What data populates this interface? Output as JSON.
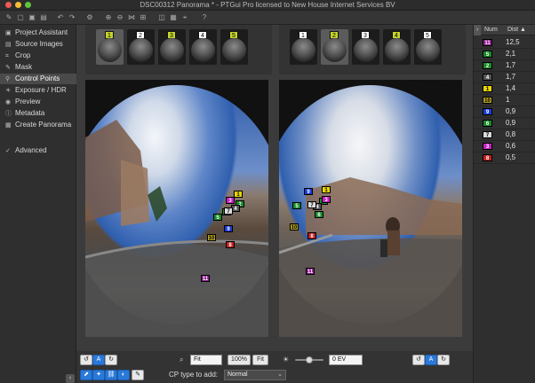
{
  "window": {
    "title": "DSC00312 Panorama * - PTGui Pro licensed to New House Internet Services BV"
  },
  "sidebar": {
    "items": [
      {
        "label": "Project Assistant",
        "icon": "project-assistant-icon",
        "glyph": "▣"
      },
      {
        "label": "Source Images",
        "icon": "source-images-icon",
        "glyph": "▤"
      },
      {
        "label": "Crop",
        "icon": "crop-icon",
        "glyph": "⌗"
      },
      {
        "label": "Mask",
        "icon": "mask-icon",
        "glyph": "✎"
      },
      {
        "label": "Control Points",
        "icon": "control-points-icon",
        "glyph": "⚲"
      },
      {
        "label": "Exposure / HDR",
        "icon": "exposure-icon",
        "glyph": "☀"
      },
      {
        "label": "Preview",
        "icon": "preview-icon",
        "glyph": "◉"
      },
      {
        "label": "Metadata",
        "icon": "metadata-icon",
        "glyph": "ⓘ"
      },
      {
        "label": "Create Panorama",
        "icon": "create-panorama-icon",
        "glyph": "▦"
      },
      {
        "label": "Advanced",
        "icon": "advanced-icon",
        "glyph": "✓"
      }
    ]
  },
  "thumbs_left": [
    {
      "n": "1",
      "color": "#c4d42a"
    },
    {
      "n": "2",
      "color": "#ffffff"
    },
    {
      "n": "3",
      "color": "#c4d42a"
    },
    {
      "n": "4",
      "color": "#ffffff"
    },
    {
      "n": "5",
      "color": "#c4d42a"
    }
  ],
  "thumbs_right": [
    {
      "n": "1",
      "color": "#ffffff"
    },
    {
      "n": "2",
      "color": "#c4d42a"
    },
    {
      "n": "3",
      "color": "#ffffff"
    },
    {
      "n": "4",
      "color": "#c4d42a"
    },
    {
      "n": "5",
      "color": "#ffffff"
    }
  ],
  "points_left": [
    {
      "n": "1",
      "color": "#e8d800",
      "text": "#000"
    },
    {
      "n": "2",
      "color": "#1a8a2a",
      "text": "#fff"
    },
    {
      "n": "3",
      "color": "#c020c0",
      "text": "#fff"
    },
    {
      "n": "4",
      "color": "#555555",
      "text": "#fff"
    },
    {
      "n": "5",
      "color": "#1a8a2a",
      "text": "#fff"
    },
    {
      "n": "6",
      "color": "#1a8a2a",
      "text": "#fff"
    },
    {
      "n": "7",
      "color": "#dddddd",
      "text": "#000"
    },
    {
      "n": "8",
      "color": "#c02020",
      "text": "#fff"
    },
    {
      "n": "9",
      "color": "#1a3ad8",
      "text": "#fff"
    },
    {
      "n": "10",
      "color": "#b0a020",
      "text": "#000"
    },
    {
      "n": "11",
      "color": "#8a1a8a",
      "text": "#fff"
    }
  ],
  "points_right": [
    {
      "n": "1",
      "color": "#e8d800",
      "text": "#000"
    },
    {
      "n": "2",
      "color": "#1a8a2a",
      "text": "#fff"
    },
    {
      "n": "3",
      "color": "#c020c0",
      "text": "#fff"
    },
    {
      "n": "4",
      "color": "#555555",
      "text": "#fff"
    },
    {
      "n": "5",
      "color": "#1a8a2a",
      "text": "#fff"
    },
    {
      "n": "6",
      "color": "#1a8a2a",
      "text": "#fff"
    },
    {
      "n": "7",
      "color": "#dddddd",
      "text": "#000"
    },
    {
      "n": "8",
      "color": "#c02020",
      "text": "#fff"
    },
    {
      "n": "9",
      "color": "#1a3ad8",
      "text": "#fff"
    },
    {
      "n": "10",
      "color": "#b0a020",
      "text": "#000"
    },
    {
      "n": "11",
      "color": "#8a1a8a",
      "text": "#fff"
    }
  ],
  "bottom": {
    "zoom_value": "Fit",
    "zoom_100": "100%",
    "zoom_fit": "Fit",
    "ev_value": "0 EV",
    "cp_type_label": "CP type to add:",
    "cp_type_value": "Normal",
    "auto_label": "A"
  },
  "table": {
    "header_num": "Num",
    "header_dist": "Dist ▲",
    "rows": [
      {
        "num": "11",
        "dist": "12,5",
        "color": "#8a1a8a",
        "text": "#fff"
      },
      {
        "num": "5",
        "dist": "2,1",
        "color": "#1a8a2a",
        "text": "#fff"
      },
      {
        "num": "2",
        "dist": "1,7",
        "color": "#1a8a2a",
        "text": "#fff"
      },
      {
        "num": "4",
        "dist": "1,7",
        "color": "#555555",
        "text": "#fff"
      },
      {
        "num": "1",
        "dist": "1,4",
        "color": "#e8d800",
        "text": "#000"
      },
      {
        "num": "10",
        "dist": "1",
        "color": "#b0a020",
        "text": "#000"
      },
      {
        "num": "9",
        "dist": "0,9",
        "color": "#1a3ad8",
        "text": "#fff"
      },
      {
        "num": "6",
        "dist": "0,9",
        "color": "#1a8a2a",
        "text": "#fff"
      },
      {
        "num": "7",
        "dist": "0,8",
        "color": "#dddddd",
        "text": "#000"
      },
      {
        "num": "3",
        "dist": "0,6",
        "color": "#c020c0",
        "text": "#fff"
      },
      {
        "num": "8",
        "dist": "0,5",
        "color": "#c02020",
        "text": "#fff"
      }
    ]
  }
}
